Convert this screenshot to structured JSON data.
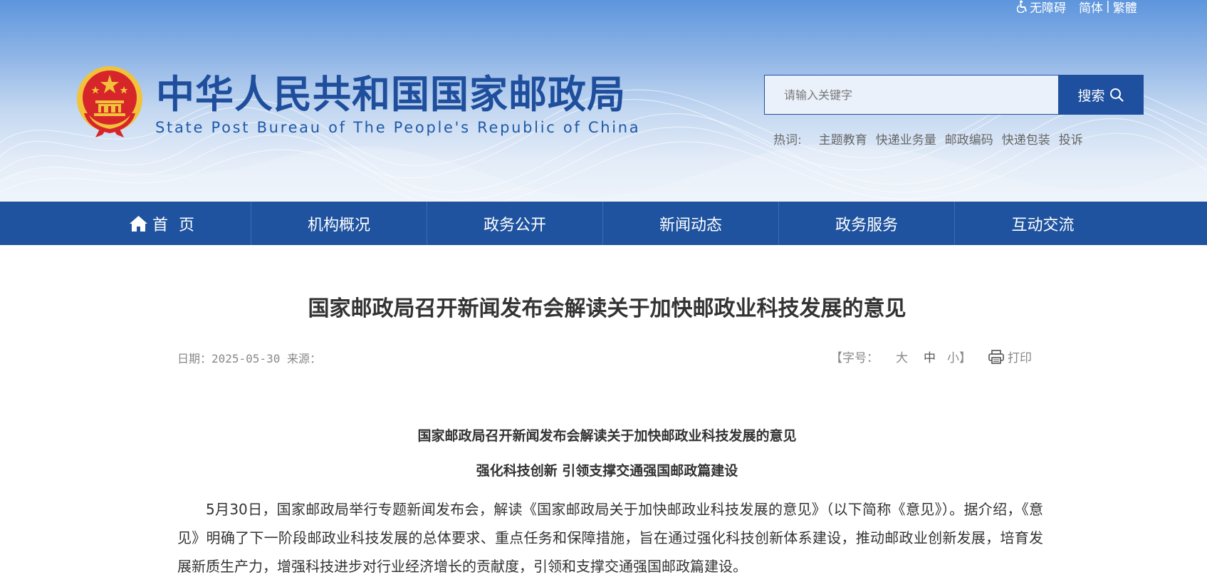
{
  "top_links": {
    "accessibility": "无障碍",
    "simplified": "简体",
    "separator": "|",
    "traditional": "繁體"
  },
  "site": {
    "title": "中华人民共和国国家邮政局",
    "subtitle": "State Post Bureau of The People's Republic of China"
  },
  "search": {
    "placeholder": "请输入关键字",
    "button_label": "搜索"
  },
  "hot_words": {
    "label": "热词:",
    "items": [
      "主题教育",
      "快递业务量",
      "邮政编码",
      "快递包装",
      "投诉"
    ]
  },
  "nav": {
    "items": [
      {
        "label": "首 页",
        "icon": "home-icon"
      },
      {
        "label": "机构概况"
      },
      {
        "label": "政务公开"
      },
      {
        "label": "新闻动态"
      },
      {
        "label": "政务服务"
      },
      {
        "label": "互动交流"
      }
    ]
  },
  "article": {
    "title": "国家邮政局召开新闻发布会解读关于加快邮政业科技发展的意见",
    "date_line": "日期：2025-05-30 来源：",
    "font_size_label": "【字号：",
    "font_big": "大",
    "font_mid": "中",
    "font_small": "小】",
    "print_label": "打印",
    "heading1": "国家邮政局召开新闻发布会解读关于加快邮政业科技发展的意见",
    "heading2": "强化科技创新 引领支撑交通强国邮政篇建设",
    "paragraph1": "5月30日，国家邮政局举行专题新闻发布会，解读《国家邮政局关于加快邮政业科技发展的意见》（以下简称《意见》）。据介绍，《意见》明确了下一阶段邮政业科技发展的总体要求、重点任务和保障措施，旨在通过强化科技创新体系建设，推动邮政业创新发展，培育发展新质生产力，增强科技进步对行业经济增长的贡献度，引领和支撑交通强国邮政篇建设。"
  },
  "colors": {
    "brand_blue": "#1f539f",
    "title_blue": "#1e4e9c",
    "emblem_red": "#d7262a",
    "emblem_gold": "#f2c23a"
  }
}
